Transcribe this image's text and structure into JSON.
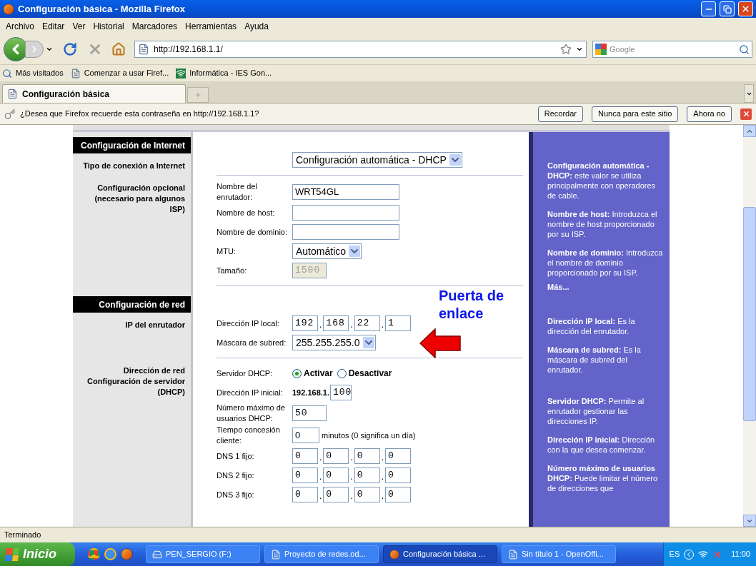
{
  "window": {
    "title": "Configuración básica - Mozilla Firefox"
  },
  "menu": [
    "Archivo",
    "Editar",
    "Ver",
    "Historial",
    "Marcadores",
    "Herramientas",
    "Ayuda"
  ],
  "toolbar": {
    "url": "http://192.168.1.1/",
    "search_placeholder": "Google"
  },
  "bookmarks": [
    {
      "label": "Más visitados",
      "kind": "search"
    },
    {
      "label": "Comenzar a usar Firef...",
      "kind": "page"
    },
    {
      "label": "Informática - IES Gon...",
      "kind": "site"
    }
  ],
  "tabs": [
    {
      "label": "Configuración básica",
      "selected": true
    }
  ],
  "notification": {
    "message": "¿Desea que Firefox recuerde esta contraseña en http://192.168.1.1?",
    "buttons": [
      "Recordar",
      "Nunca para este sitio",
      "Ahora no"
    ]
  },
  "page": {
    "sections": [
      {
        "heading": "Configuración de Internet",
        "groups": [
          {
            "label": "Tipo de conexión a Internet",
            "rows": [
              {
                "kind": "select",
                "value": "Configuración automática - DHCP"
              }
            ]
          },
          {
            "label": "Configuración opcional (necesario para algunos ISP)",
            "rows": [
              {
                "kind": "text",
                "label": "Nombre del enrutador:",
                "value": "WRT54GL",
                "disabled": false
              },
              {
                "kind": "text",
                "label": "Nombre de host:",
                "disabled": false
              },
              {
                "kind": "text",
                "label": "Nombre de dominio:",
                "disabled": false
              },
              {
                "kind": "select",
                "label": "MTU:",
                "value": "Automático"
              },
              {
                "kind": "text",
                "label": "Tamaño:",
                "value": "1500",
                "disabled": true
              }
            ]
          }
        ]
      },
      {
        "heading": "Configuración de red",
        "groups": [
          {
            "label": "IP del enrutador",
            "rows": [
              {
                "kind": "ip",
                "label": "Dirección IP local:",
                "octets": [
                  "192",
                  "168",
                  "22",
                  "1"
                ],
                "separator": "."
              },
              {
                "kind": "select",
                "label": "Máscara de subred:",
                "value": "255.255.255.0"
              }
            ]
          },
          {
            "label": "Dirección de red Configuración de servidor (DHCP)",
            "rows": [
              {
                "kind": "radio",
                "label": "Servidor DHCP:",
                "options": [
                  {
                    "label": "Activar",
                    "selected": true
                  },
                  {
                    "label": "Desactivar",
                    "selected": false
                  }
                ]
              },
              {
                "kind": "prefixed",
                "label": "Dirección IP inicial:",
                "prefix": "192.168.1.",
                "value": "100"
              },
              {
                "kind": "text",
                "label": "Número máximo de usuarios DHCP:",
                "value": "50",
                "disabled": false
              },
              {
                "kind": "suffixed",
                "label": "Tiempo concesión cliente:",
                "value": "0",
                "suffix": "minutos (0 significa un día)"
              },
              {
                "kind": "ip",
                "label": "DNS 1 fijo:",
                "octets": [
                  "0",
                  "0",
                  "0",
                  "0"
                ],
                "separator": "."
              },
              {
                "kind": "ip",
                "label": "DNS 2 fijo:",
                "octets": [
                  "0",
                  "0",
                  "0",
                  "0"
                ],
                "separator": "."
              },
              {
                "kind": "ip",
                "label": "DNS 3 fijo:",
                "octets": [
                  "0",
                  "0",
                  "0",
                  "0"
                ],
                "separator": "."
              }
            ]
          }
        ]
      }
    ],
    "help": [
      [
        "**Configuración automática - DHCP:** este valor se utiliza principalmente con operadores de cable.",
        "**Nombre de host:** Introduzca el nombre de host proporcionado por su ISP.",
        "**Nombre de dominio:** Introduzca el nombre de dominio proporcionado por su ISP."
      ],
      [
        "**Dirección IP local:** Es la dirección del enrutador.",
        "**Máscara de subred:** Es la máscara de subred del enrutador."
      ],
      [
        "**Servidor DHCP:** Permite al enrutador gestionar las direcciones IP.",
        "**Dirección IP inicial:** Dirección con la que desea comenzar.",
        "**Número máximo de usuarios DHCP:** Puede limitar el número de direcciones que"
      ]
    ],
    "help_link": "Más...",
    "annotation": {
      "text": "Puerta de enlace"
    }
  },
  "status_bar": "Terminado",
  "taskbar": {
    "start": "Inicio",
    "tasks": [
      {
        "label": "PEN_SERGIO (F:)",
        "kind": "drive",
        "selected": false
      },
      {
        "label": "Proyecto de redes.od...",
        "kind": "doc",
        "selected": false
      },
      {
        "label": "Configuración básica ...",
        "kind": "browser",
        "selected": true
      },
      {
        "label": "Sin título 1 - OpenOffi...",
        "kind": "doc",
        "selected": false
      }
    ],
    "language": "ES",
    "clock": "11:00"
  }
}
